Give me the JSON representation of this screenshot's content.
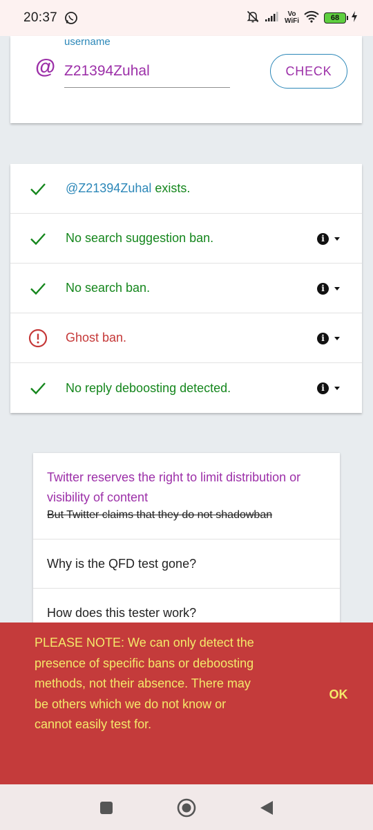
{
  "status_bar": {
    "time": "20:37",
    "battery": "68",
    "vowifi_top": "Vo",
    "vowifi_bottom": "WiFi",
    "icons": [
      "whatsapp-icon",
      "bell-off-icon",
      "signal-icon",
      "wifi-icon",
      "battery-icon",
      "charging-icon"
    ]
  },
  "username_card": {
    "label": "username",
    "at_symbol": "@",
    "value": "Z21394Zuhal",
    "check_label": "CHECK"
  },
  "results": [
    {
      "status": "ok",
      "handle": "@Z21394Zuhal",
      "text": " exists.",
      "has_info": false
    },
    {
      "status": "ok",
      "text": "No search suggestion ban.",
      "has_info": true
    },
    {
      "status": "ok",
      "text": "No search ban.",
      "has_info": true
    },
    {
      "status": "bad",
      "text": "Ghost ban.",
      "has_info": true
    },
    {
      "status": "ok",
      "text": "No reply deboosting detected.",
      "has_info": true
    }
  ],
  "faq": {
    "item1_title": "Twitter reserves the right to limit distribution or visibility of content",
    "item1_strike": "But Twitter claims that they do not shadowban",
    "item2": "Why is the QFD test gone?",
    "item3": "How does this tester work?"
  },
  "snackbar": {
    "message": "PLEASE NOTE: We can only detect the presence of specific bans or deboosting methods, not their absence. There may be others which we do not know or cannot easily test for.",
    "ok_label": "OK"
  },
  "colors": {
    "purple": "#9c2fa8",
    "blue": "#2b87b8",
    "green": "#14861c",
    "red": "#c53838",
    "snackbar_bg": "#c43b3b",
    "snackbar_text": "#f4e96a"
  }
}
